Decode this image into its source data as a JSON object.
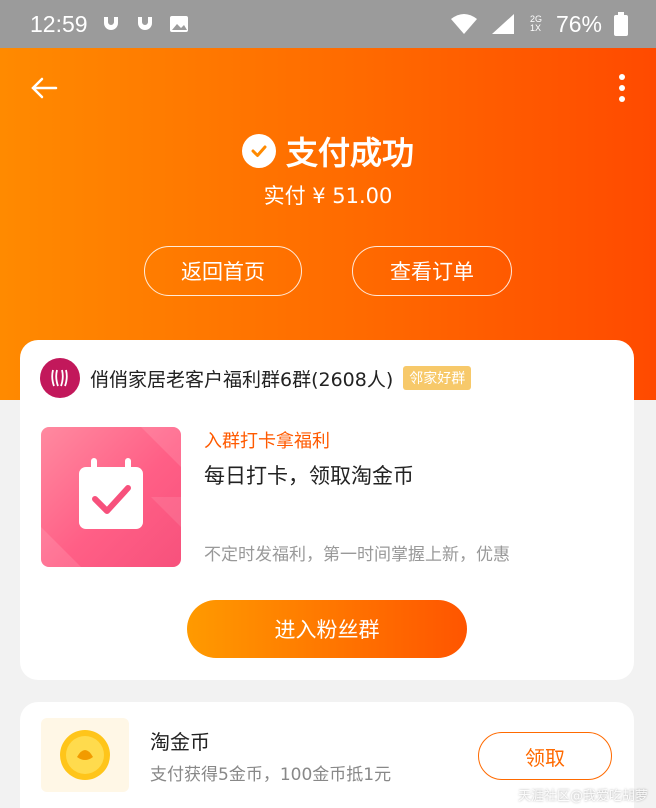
{
  "status_bar": {
    "time": "12:59",
    "battery": "76%",
    "network_label": "2G 1X",
    "icons": [
      "notification-icon",
      "notification-icon",
      "image-icon",
      "wifi-icon",
      "signal-icon",
      "battery-icon"
    ]
  },
  "header": {
    "back_icon": "arrow-left-icon",
    "more_icon": "more-vertical-icon"
  },
  "payment": {
    "status_title": "支付成功",
    "paid_amount": "实付 ¥ 51.00",
    "buttons": {
      "home": "返回首页",
      "order": "查看订单"
    }
  },
  "group": {
    "name": "俏俏家居老客户福利群6群(2608人)",
    "tag": "邻家好群",
    "promo_title": "入群打卡拿福利",
    "promo_subtitle": "每日打卡，领取淘金币",
    "promo_desc": "不定时发福利，第一时间掌握上新，优惠",
    "join_button": "进入粉丝群"
  },
  "coins": {
    "title": "淘金币",
    "subtitle": "支付获得5金币，100金币抵1元",
    "claim_button": "领取"
  },
  "watermark": "天涯社区@我爱吃胡萝",
  "colors": {
    "accent": "#ff6a00",
    "hero_start": "#ff8a00",
    "hero_end": "#ff4a00",
    "promo_pink": "#ff5f86",
    "tag_yellow": "#f7c96a"
  }
}
